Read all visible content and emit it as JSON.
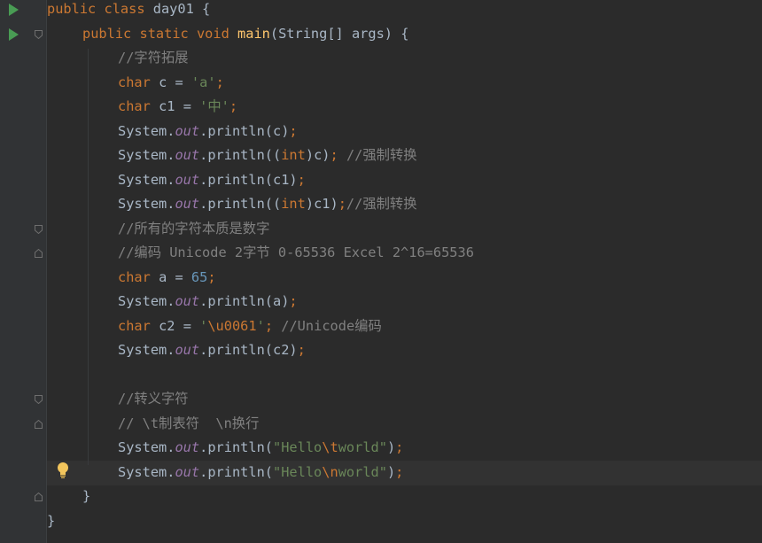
{
  "code": {
    "line1": {
      "kw1": "public",
      "kw2": "class",
      "name": "day01",
      "brace": "{"
    },
    "line2": {
      "kw1": "public",
      "kw2": "static",
      "kw3": "void",
      "fn": "main",
      "params": "(String[] args)",
      "brace": "{"
    },
    "line3": {
      "comment": "//字符拓展"
    },
    "line4": {
      "kw": "char",
      "id": "c =",
      "str": "'a'",
      "semi": ";"
    },
    "line5": {
      "kw": "char",
      "id": "c1 =",
      "str": "'中'",
      "semi": ";"
    },
    "line6": {
      "sys": "System.",
      "fld": "out",
      "call": ".println(c)",
      "semi": ";"
    },
    "line7": {
      "sys": "System.",
      "fld": "out",
      "call1": ".println((",
      "kw": "int",
      "call2": ")c)",
      "semi": ";",
      "comment": "//强制转换"
    },
    "line8": {
      "sys": "System.",
      "fld": "out",
      "call": ".println(c1)",
      "semi": ";"
    },
    "line9": {
      "sys": "System.",
      "fld": "out",
      "call1": ".println((",
      "kw": "int",
      "call2": ")c1)",
      "semi": ";",
      "comment": "//强制转换"
    },
    "line10": {
      "comment": "//所有的字符本质是数字"
    },
    "line11": {
      "comment": "//编码 Unicode 2字节 0-65536 Excel 2^16=65536"
    },
    "line12": {
      "kw": "char",
      "id": "a =",
      "num": "65",
      "semi": ";"
    },
    "line13": {
      "sys": "System.",
      "fld": "out",
      "call": ".println(a)",
      "semi": ";"
    },
    "line14": {
      "kw": "char",
      "id": "c2 =",
      "str1": "'",
      "esc": "\\u0061",
      "str2": "'",
      "semi": ";",
      "comment": "//Unicode编码"
    },
    "line15": {
      "sys": "System.",
      "fld": "out",
      "call": ".println(c2)",
      "semi": ";"
    },
    "line17": {
      "comment": "//转义字符"
    },
    "line18": {
      "comment": "// \\t制表符  \\n换行"
    },
    "line19": {
      "sys": "System.",
      "fld": "out",
      "call1": ".println(",
      "str1": "\"Hello",
      "esc": "\\t",
      "str2": "world\"",
      "call2": ")",
      "semi": ";"
    },
    "line20": {
      "sys": "System.",
      "fld": "out",
      "call1": ".println(",
      "str1": "\"Hello",
      "esc": "\\n",
      "str2": "world\"",
      "call2": ")",
      "semi": ";"
    },
    "line21": {
      "brace": "}"
    },
    "line22": {
      "brace": "}"
    }
  },
  "icons": {
    "run": "run-icon",
    "fold": "fold-icon",
    "intention": "intention-bulb-icon"
  },
  "colors": {
    "background": "#2b2b2b",
    "gutter": "#313335",
    "keyword": "#cc7832",
    "function": "#ffc66d",
    "string": "#6a8759",
    "number": "#6897bb",
    "comment": "#808080",
    "field": "#9876aa",
    "text": "#a9b7c6",
    "run_icon": "#499c54"
  }
}
